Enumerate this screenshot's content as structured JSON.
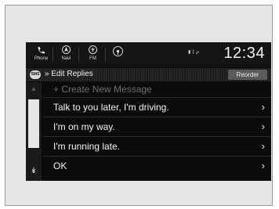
{
  "topbar": {
    "phone_label": "Phone",
    "navi_label": "Navi",
    "fm_label": "FM",
    "status_text": "▮ ‡ ℘",
    "clock": "12:34"
  },
  "header": {
    "badge": "SMS",
    "breadcrumb": "» Edit Replies",
    "reorder_label": "Reorder"
  },
  "list": {
    "create_label": "+ Create New Message",
    "items": [
      {
        "label": "Talk to you later, I'm driving."
      },
      {
        "label": "I'm on my way."
      },
      {
        "label": "I'm running late."
      },
      {
        "label": "OK"
      }
    ],
    "chevron": "›"
  },
  "scrollbar": {
    "up_glyph": "▲",
    "down_glyph": "↡"
  },
  "icons": {
    "phone": "phone-icon",
    "navi": "navigation-icon",
    "fm": "radio-icon",
    "media": "media-icon"
  },
  "colors": {
    "screen_bg": "#0b0b0b",
    "text": "#f2f2f2",
    "muted_text": "#6e6e6e",
    "reorder_bg": "#5a5a5a",
    "scroll_thumb": "#e6e6e6"
  }
}
